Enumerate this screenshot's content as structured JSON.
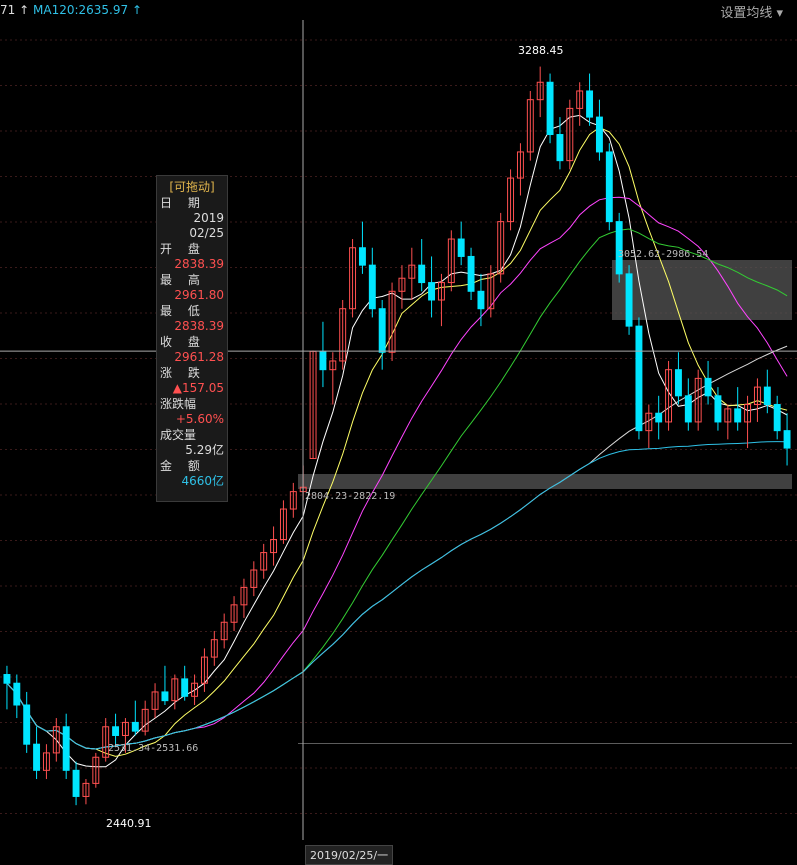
{
  "header": {
    "ma60_label": "71 ↑",
    "ma120_label": "MA120:2635.97 ↑",
    "set_ma_button": "设置均线 ▾"
  },
  "info_panel": {
    "title": "[可拖动]",
    "date_label": "日  期",
    "date_year": "2019",
    "date_md": "02/25",
    "open_label": "开  盘",
    "open_value": "2838.39",
    "high_label": "最  高",
    "high_value": "2961.80",
    "low_label": "最  低",
    "low_value": "2838.39",
    "close_label": "收  盘",
    "close_value": "2961.28",
    "change_label": "涨  跌",
    "change_value": "▲157.05",
    "pct_label": "涨跌幅",
    "pct_value": "+5.60%",
    "volume_label": "成交量",
    "volume_value": "5.29亿",
    "amount_label": "金  额",
    "amount_value": "4660亿"
  },
  "crosshair": {
    "date_tag": "2019/02/25/一"
  },
  "annotations": {
    "peak": "3288.45",
    "trough": "2440.91",
    "zone_upper": "3052.62-2986.54",
    "zone_mid": "2804.23-2822.19",
    "zone_low": "2531.34-2531.66"
  },
  "colors": {
    "up": "#ff5050",
    "down": "#00e5ff",
    "ma5": "#ffffff",
    "ma10": "#ffff66",
    "ma20": "#ff44ff",
    "ma30": "#33cc33",
    "ma60": "#d8d8d8",
    "ma120": "#2fc0e6"
  },
  "chart_data": {
    "type": "candlestick",
    "y_range": [
      2400,
      3330
    ],
    "crosshair_price": 2961.28,
    "zones": [
      {
        "low": 2986.54,
        "high": 3052.62
      },
      {
        "low": 2804.23,
        "high": 2822.19
      },
      {
        "low": 2531.34,
        "high": 2531.66
      }
    ],
    "candles": [
      [
        2590,
        2600,
        2550,
        2580
      ],
      [
        2580,
        2590,
        2540,
        2555
      ],
      [
        2555,
        2570,
        2500,
        2510
      ],
      [
        2510,
        2530,
        2470,
        2480
      ],
      [
        2480,
        2510,
        2470,
        2500
      ],
      [
        2500,
        2540,
        2490,
        2530
      ],
      [
        2530,
        2545,
        2470,
        2480
      ],
      [
        2480,
        2490,
        2440,
        2450
      ],
      [
        2450,
        2470,
        2441,
        2465
      ],
      [
        2465,
        2500,
        2460,
        2495
      ],
      [
        2495,
        2540,
        2490,
        2530
      ],
      [
        2530,
        2545,
        2510,
        2520
      ],
      [
        2520,
        2540,
        2500,
        2535
      ],
      [
        2535,
        2560,
        2520,
        2525
      ],
      [
        2525,
        2560,
        2520,
        2550
      ],
      [
        2550,
        2580,
        2540,
        2570
      ],
      [
        2570,
        2600,
        2555,
        2560
      ],
      [
        2560,
        2590,
        2550,
        2585
      ],
      [
        2585,
        2600,
        2560,
        2565
      ],
      [
        2565,
        2590,
        2555,
        2580
      ],
      [
        2580,
        2620,
        2570,
        2610
      ],
      [
        2610,
        2640,
        2600,
        2630
      ],
      [
        2630,
        2660,
        2620,
        2650
      ],
      [
        2650,
        2680,
        2640,
        2670
      ],
      [
        2670,
        2700,
        2655,
        2690
      ],
      [
        2690,
        2720,
        2680,
        2710
      ],
      [
        2710,
        2740,
        2700,
        2730
      ],
      [
        2730,
        2760,
        2715,
        2745
      ],
      [
        2745,
        2790,
        2740,
        2780
      ],
      [
        2780,
        2810,
        2770,
        2800
      ],
      [
        2800,
        2830,
        2790,
        2805
      ],
      [
        2838,
        2962,
        2838,
        2961
      ],
      [
        2961,
        2995,
        2920,
        2940
      ],
      [
        2940,
        2960,
        2900,
        2950
      ],
      [
        2950,
        3020,
        2940,
        3010
      ],
      [
        3010,
        3090,
        3000,
        3080
      ],
      [
        3080,
        3110,
        3050,
        3060
      ],
      [
        3060,
        3080,
        3000,
        3010
      ],
      [
        3010,
        3020,
        2940,
        2960
      ],
      [
        2960,
        3040,
        2950,
        3030
      ],
      [
        3030,
        3060,
        3010,
        3045
      ],
      [
        3045,
        3080,
        3020,
        3060
      ],
      [
        3060,
        3090,
        3030,
        3040
      ],
      [
        3040,
        3070,
        3000,
        3020
      ],
      [
        3020,
        3050,
        2990,
        3040
      ],
      [
        3040,
        3100,
        3030,
        3090
      ],
      [
        3090,
        3110,
        3060,
        3070
      ],
      [
        3070,
        3080,
        3020,
        3030
      ],
      [
        3030,
        3050,
        2990,
        3010
      ],
      [
        3010,
        3060,
        3000,
        3050
      ],
      [
        3050,
        3120,
        3040,
        3110
      ],
      [
        3110,
        3170,
        3100,
        3160
      ],
      [
        3160,
        3200,
        3140,
        3190
      ],
      [
        3190,
        3260,
        3180,
        3250
      ],
      [
        3250,
        3288,
        3230,
        3270
      ],
      [
        3270,
        3280,
        3200,
        3210
      ],
      [
        3210,
        3230,
        3170,
        3180
      ],
      [
        3180,
        3250,
        3170,
        3240
      ],
      [
        3240,
        3270,
        3220,
        3260
      ],
      [
        3260,
        3280,
        3220,
        3230
      ],
      [
        3230,
        3250,
        3180,
        3190
      ],
      [
        3190,
        3200,
        3100,
        3110
      ],
      [
        3110,
        3120,
        3040,
        3050
      ],
      [
        3050,
        3060,
        2980,
        2990
      ],
      [
        2990,
        3000,
        2860,
        2870
      ],
      [
        2870,
        2900,
        2850,
        2890
      ],
      [
        2890,
        2910,
        2860,
        2880
      ],
      [
        2880,
        2950,
        2870,
        2940
      ],
      [
        2940,
        2960,
        2900,
        2910
      ],
      [
        2910,
        2930,
        2870,
        2880
      ],
      [
        2880,
        2940,
        2870,
        2930
      ],
      [
        2930,
        2950,
        2900,
        2910
      ],
      [
        2910,
        2920,
        2870,
        2880
      ],
      [
        2880,
        2900,
        2860,
        2895
      ],
      [
        2895,
        2920,
        2870,
        2880
      ],
      [
        2880,
        2910,
        2850,
        2900
      ],
      [
        2900,
        2930,
        2880,
        2920
      ],
      [
        2920,
        2940,
        2890,
        2900
      ],
      [
        2900,
        2910,
        2860,
        2870
      ],
      [
        2870,
        2890,
        2830,
        2850
      ]
    ]
  }
}
